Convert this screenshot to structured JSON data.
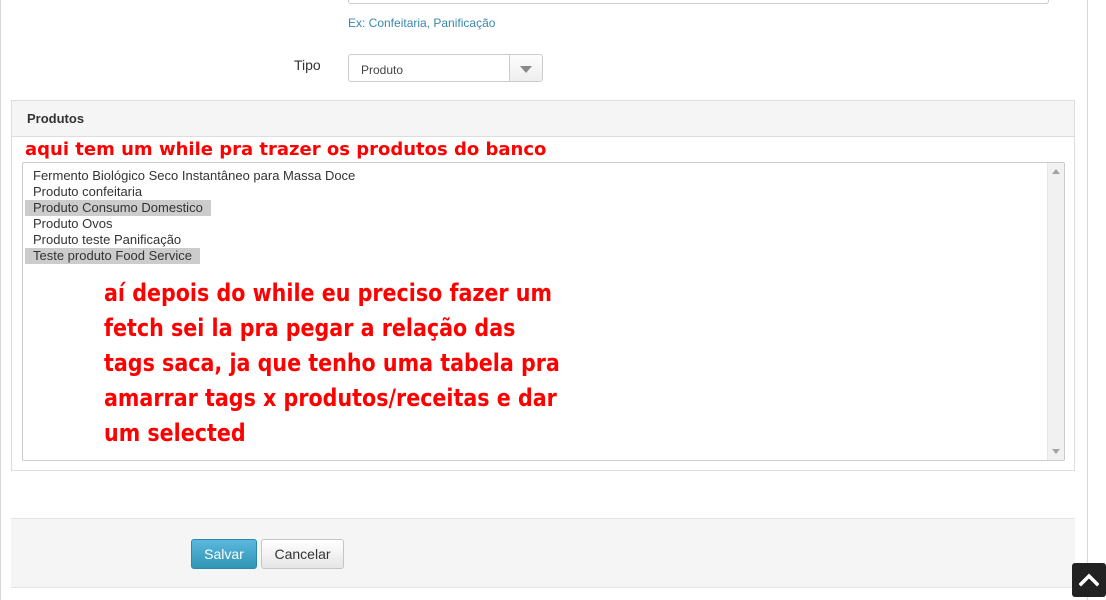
{
  "form": {
    "category_help_text": "Ex: Confeitaria, Panificação",
    "tipo_label": "Tipo",
    "tipo_select_value": "Produto"
  },
  "produtos_panel": {
    "title": "Produtos",
    "options": [
      {
        "label": "Fermento Biológico Seco Instantâneo para Massa Doce",
        "selected": false
      },
      {
        "label": "Produto confeitaria",
        "selected": false
      },
      {
        "label": "Produto Consumo Domestico",
        "selected": true
      },
      {
        "label": "Produto Ovos",
        "selected": false
      },
      {
        "label": "Produto teste Panificação",
        "selected": false
      },
      {
        "label": "Teste produto Food Service",
        "selected": true
      }
    ]
  },
  "annotations": {
    "note_1": "aqui tem um while pra trazer os produtos do banco",
    "note_2": "aí depois do while eu preciso fazer um fetch sei la pra pegar a relação das tags saca, ja que tenho uma tabela pra amarrar tags x produtos/receitas e dar um selected",
    "color": "#ff0000"
  },
  "actions": {
    "save_label": "Salvar",
    "cancel_label": "Cancelar"
  },
  "icons": {
    "select_arrow": "chevron-down-icon",
    "scroll_top": "chevron-up-icon"
  }
}
